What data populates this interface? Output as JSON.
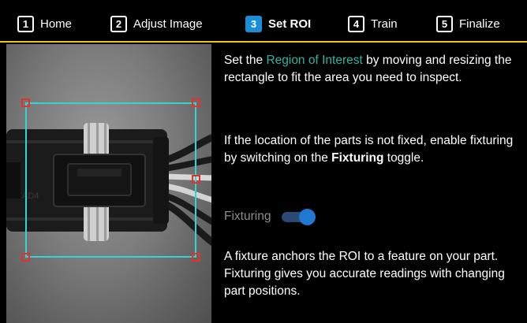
{
  "steps": [
    {
      "num": "1",
      "label": "Home",
      "active": false
    },
    {
      "num": "2",
      "label": "Adjust Image",
      "active": false
    },
    {
      "num": "3",
      "label": "Set ROI",
      "active": true
    },
    {
      "num": "4",
      "label": "Train",
      "active": false
    },
    {
      "num": "5",
      "label": "Finalize",
      "active": false
    }
  ],
  "instructions": {
    "p1_before": "Set the ",
    "p1_link": "Region of Interest",
    "p1_after": " by moving and resizing the rectangle to fit the area you need to inspect.",
    "p2_before": "If the location of the parts is not fixed, enable fixturing by switching on the ",
    "p2_bold": "Fixturing",
    "p2_after": " toggle.",
    "p3": "A fixture anchors the ROI to a feature on your part. Fixturing gives you accurate readings with changing part positions."
  },
  "fixturing": {
    "label": "Fixturing",
    "on": true
  },
  "image": {
    "part_marking": "AD4"
  },
  "colors": {
    "active_step": "#1a8fd8",
    "step_underline": "#f1c40f",
    "link": "#2bb5a5",
    "roi_border": "#36d3d3",
    "roi_handle": "#e8302a",
    "toggle_knob": "#1f78d1"
  }
}
